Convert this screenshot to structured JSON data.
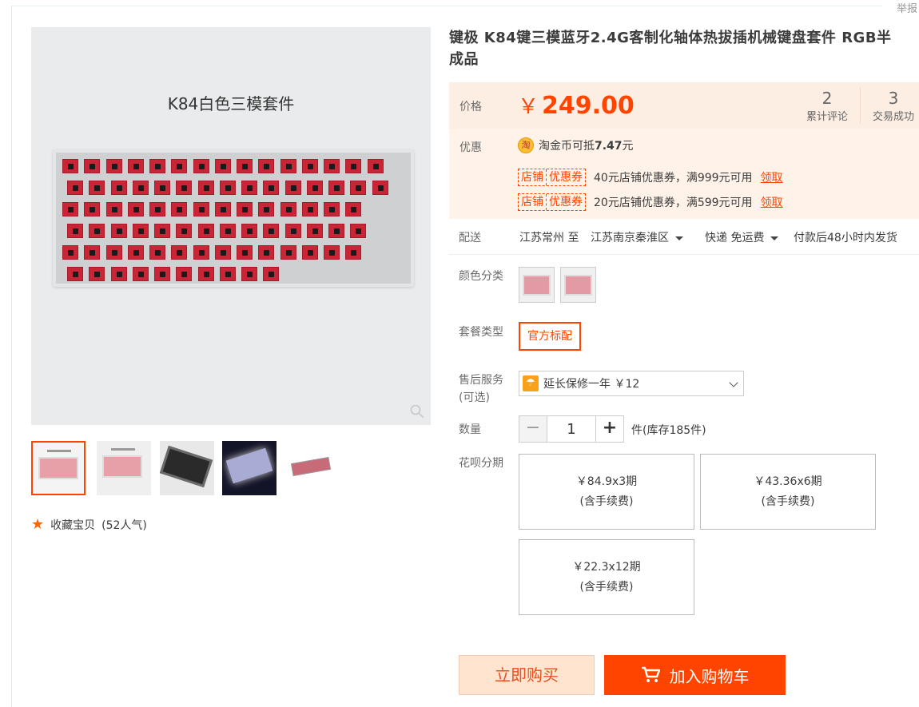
{
  "header": {
    "report_label": "举报"
  },
  "gallery": {
    "main_caption": "K84白色三模套件",
    "favorite": {
      "label": "收藏宝贝",
      "count_text": "(52人气)"
    }
  },
  "product": {
    "title_line1": "键极 K84键三模蓝牙2.4G客制化轴体热拔插机械键盘套件 RGB半",
    "title_line2": "成品"
  },
  "price": {
    "label": "价格",
    "currency": "￥",
    "amount": "249.00",
    "reviews": {
      "count": "2",
      "label": "累计评论"
    },
    "deals": {
      "count": "3",
      "label": "交易成功"
    }
  },
  "promo": {
    "label": "优惠",
    "taojin_icon": "淘",
    "taojin_prefix": "淘金币可抵",
    "taojin_amount": "7.47",
    "taojin_suffix": "元",
    "coupons": [
      {
        "tag_a": "店铺",
        "tag_b": "优惠券",
        "text": "40元店铺优惠券，满999元可用",
        "link": "领取"
      },
      {
        "tag_a": "店铺",
        "tag_b": "优惠券",
        "text": "20元店铺优惠券，满599元可用",
        "link": "领取"
      }
    ]
  },
  "shipping": {
    "label": "配送",
    "from": "江苏常州 至",
    "to": "江苏南京秦淮区",
    "method": "快递 免运费",
    "dispatch": "付款后48小时内发货"
  },
  "options": {
    "color_label": "颜色分类",
    "package_label": "套餐类型",
    "package_value": "官方标配",
    "service_label": "售后服务",
    "service_optional": "(可选)",
    "service_icon": "☂",
    "service_value": "延长保修一年 ￥12",
    "qty_label": "数量",
    "qty_value": "1",
    "qty_minus": "−",
    "qty_plus": "+",
    "stock_text": "件(库存185件)"
  },
  "installments": {
    "label": "花呗分期",
    "plans": [
      {
        "amount": "￥84.9x3期",
        "note": "(含手续费)"
      },
      {
        "amount": "￥43.36x6期",
        "note": "(含手续费)"
      },
      {
        "amount": "￥22.3x12期",
        "note": "(含手续费)"
      }
    ]
  },
  "actions": {
    "buy_now": "立即购买",
    "add_cart": "加入购物车"
  },
  "colors": {
    "accent": "#ff4400",
    "price": "#ff4400",
    "pricebox_bg": "#fff2e8"
  },
  "icons": {
    "zoom": "magnifier-icon",
    "star": "star-icon",
    "cart": "cart-icon",
    "caret": "caret-down-icon"
  }
}
